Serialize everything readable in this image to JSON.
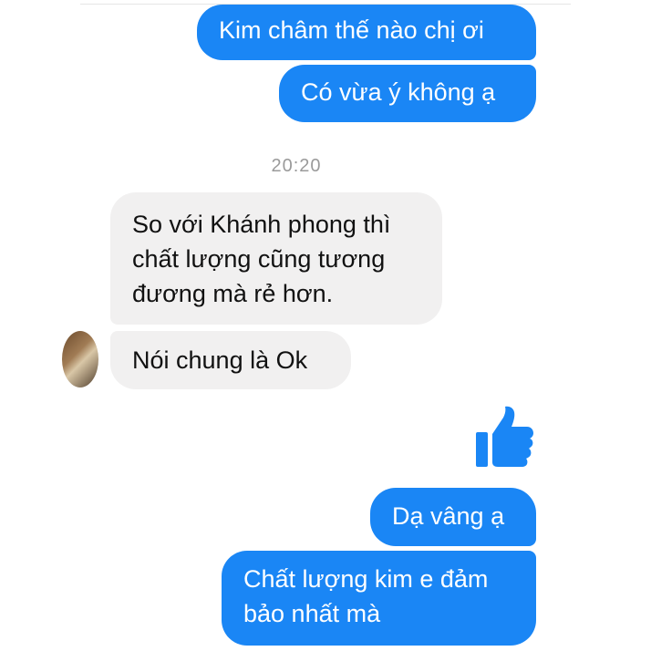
{
  "messages": {
    "m1": "Kim châm thế nào chị ơi",
    "m2": "Có vừa ý không ạ",
    "timestamp": "20:20",
    "m3": "So với Khánh phong thì chất lượng cũng tương đương mà rẻ hơn.",
    "m4": "Nói chung là Ok",
    "m5": "Dạ vâng ạ",
    "m6": "Chất lượng kim e đảm bảo nhất mà"
  },
  "icons": {
    "like": "thumbs-up-icon",
    "avatar": "contact-avatar"
  },
  "colors": {
    "outgoing_bubble": "#1a86f5",
    "incoming_bubble": "#f1f0f0",
    "timestamp_text": "#9a9a9a",
    "like_icon": "#1a86f5"
  }
}
